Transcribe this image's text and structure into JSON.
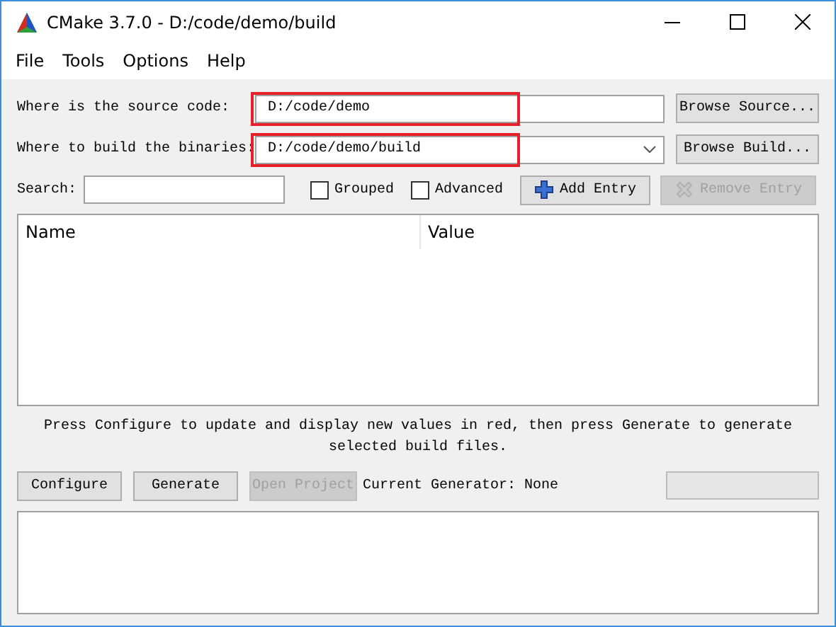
{
  "window": {
    "title": "CMake 3.7.0 - D:/code/demo/build"
  },
  "menu": [
    "File",
    "Tools",
    "Options",
    "Help"
  ],
  "paths": [
    {
      "kind": "text",
      "label": "Where is the source code:",
      "value": "D:/code/demo",
      "highlighted": true,
      "button": "Browse Source..."
    },
    {
      "kind": "combo",
      "label": "Where to build the binaries:",
      "value": "D:/code/demo/build",
      "highlighted": true,
      "button": "Browse Build..."
    }
  ],
  "search": {
    "label": "Search:"
  },
  "options": [
    {
      "label": "Grouped",
      "checked": false
    },
    {
      "label": "Advanced",
      "checked": false
    }
  ],
  "entry_buttons": [
    {
      "kind": "add",
      "label": "Add Entry",
      "disabled": false
    },
    {
      "kind": "remove",
      "label": "Remove Entry",
      "disabled": true
    }
  ],
  "table": {
    "columns": [
      "Name",
      "Value"
    ]
  },
  "message": "Press Configure to update and display new values in red, then press Generate to generate selected build files.",
  "actions": [
    {
      "label": "Configure",
      "disabled": false
    },
    {
      "label": "Generate",
      "disabled": false
    },
    {
      "label": "Open Project",
      "disabled": true
    }
  ],
  "generator": "Current Generator: None",
  "progress": {
    "level": 0
  }
}
